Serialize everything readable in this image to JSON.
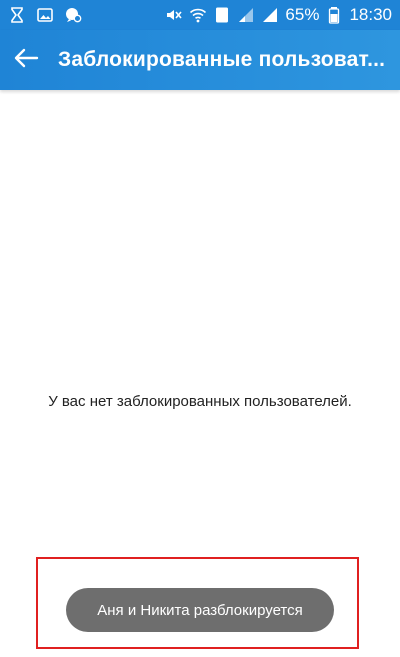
{
  "status_bar": {
    "battery_percent": "65%",
    "time": "18:30",
    "sim_badge": "2",
    "icons": [
      "hourglass-icon",
      "image-icon",
      "chat-icon",
      "mute-icon",
      "wifi-icon",
      "sim2-icon",
      "signal-icon",
      "signal-icon-2",
      "battery-icon"
    ]
  },
  "app_bar": {
    "title": "Заблокированные пользоват...",
    "back_icon": "arrow-left-icon",
    "color": "#1f84d6"
  },
  "main": {
    "empty_message": "У вас нет заблокированных пользователей."
  },
  "toast": {
    "message": "Аня и Никита разблокируется",
    "background": "#6e6e6e"
  },
  "highlight": {
    "color": "#e02020"
  }
}
